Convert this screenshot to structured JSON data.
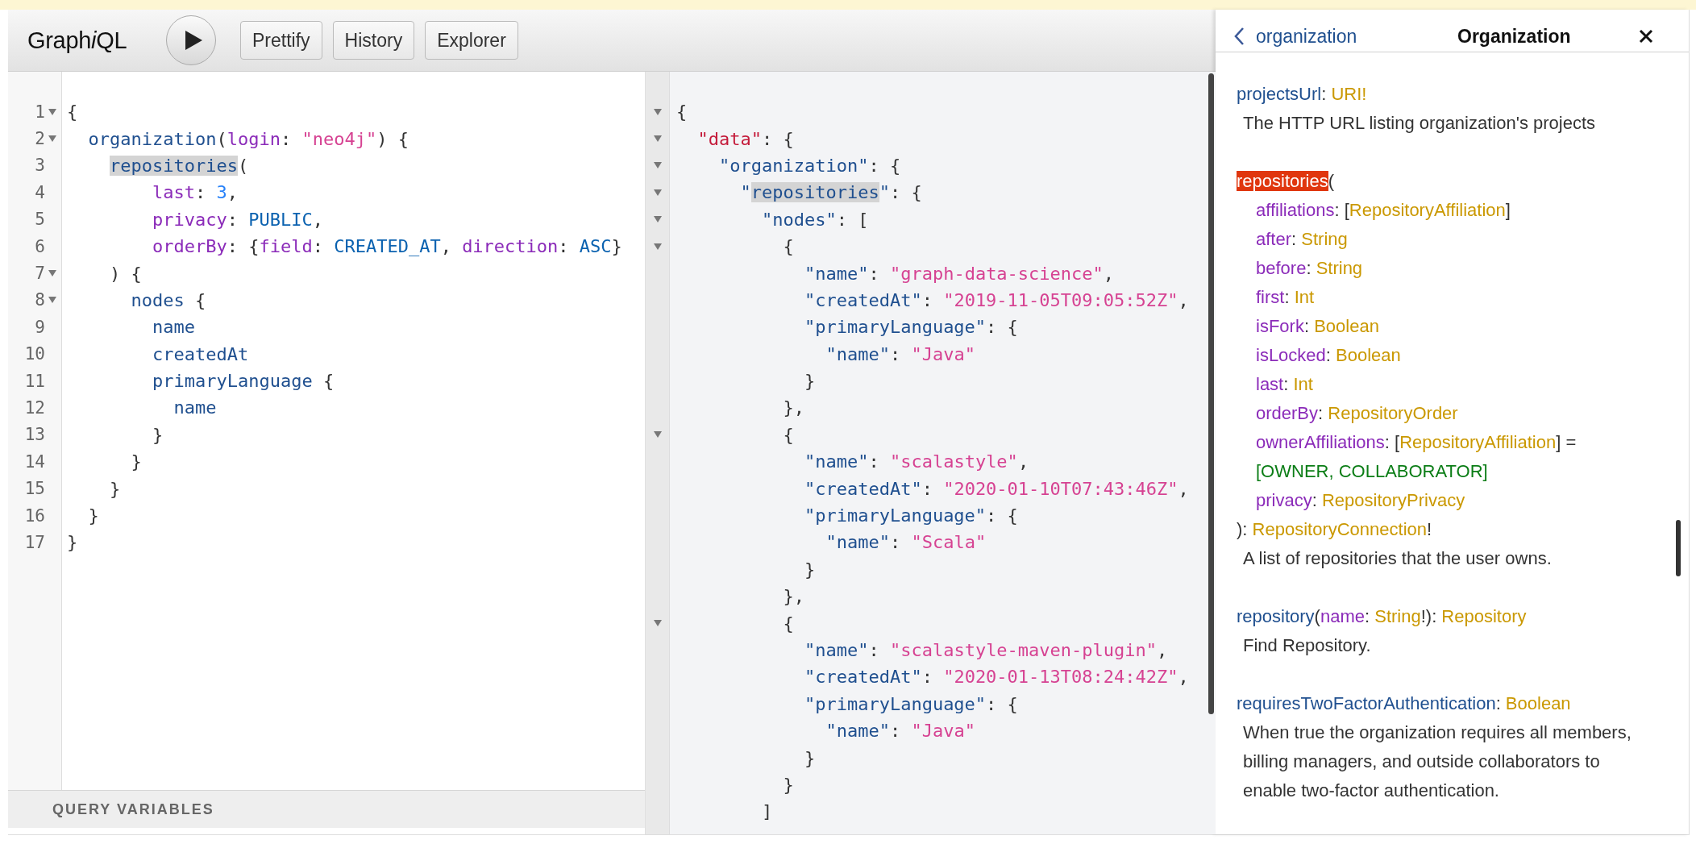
{
  "toolbar": {
    "logo": {
      "before": "Graph",
      "italic": "i",
      "after": "QL"
    },
    "buttons": [
      "Prettify",
      "History",
      "Explorer"
    ]
  },
  "query_editor": {
    "lines": [
      {
        "number": "1",
        "fold": true,
        "tokens": [
          {
            "kind": "p",
            "text": "{"
          }
        ]
      },
      {
        "number": "2",
        "fold": true,
        "tokens": [
          {
            "kind": "f",
            "text": "  organization"
          },
          {
            "kind": "p",
            "text": "("
          },
          {
            "kind": "a",
            "text": "login"
          },
          {
            "kind": "p",
            "text": ": "
          },
          {
            "kind": "s",
            "text": "\"neo4j\""
          },
          {
            "kind": "p",
            "text": ") {"
          }
        ]
      },
      {
        "number": "3",
        "fold": false,
        "tokens": [
          {
            "kind": "match",
            "text": "    repositories"
          },
          {
            "kind": "p",
            "text": "("
          }
        ]
      },
      {
        "number": "4",
        "fold": false,
        "tokens": [
          {
            "kind": "a",
            "text": "        last"
          },
          {
            "kind": "p",
            "text": ": "
          },
          {
            "kind": "n",
            "text": "3"
          },
          {
            "kind": "p",
            "text": ","
          }
        ]
      },
      {
        "number": "5",
        "fold": false,
        "tokens": [
          {
            "kind": "a",
            "text": "        privacy"
          },
          {
            "kind": "p",
            "text": ": "
          },
          {
            "kind": "e",
            "text": "PUBLIC"
          },
          {
            "kind": "p",
            "text": ","
          }
        ]
      },
      {
        "number": "6",
        "fold": false,
        "tokens": [
          {
            "kind": "a",
            "text": "        orderBy"
          },
          {
            "kind": "p",
            "text": ": {"
          },
          {
            "kind": "a",
            "text": "field"
          },
          {
            "kind": "p",
            "text": ": "
          },
          {
            "kind": "e",
            "text": "CREATED_AT"
          },
          {
            "kind": "p",
            "text": ", "
          },
          {
            "kind": "a",
            "text": "direction"
          },
          {
            "kind": "p",
            "text": ": "
          },
          {
            "kind": "e",
            "text": "ASC"
          },
          {
            "kind": "p",
            "text": "}"
          }
        ]
      },
      {
        "number": "7",
        "fold": true,
        "tokens": [
          {
            "kind": "p",
            "text": "    ) {"
          }
        ]
      },
      {
        "number": "8",
        "fold": true,
        "tokens": [
          {
            "kind": "f",
            "text": "      nodes"
          },
          {
            "kind": "p",
            "text": " {"
          }
        ]
      },
      {
        "number": "9",
        "fold": false,
        "tokens": [
          {
            "kind": "f",
            "text": "        name"
          }
        ]
      },
      {
        "number": "10",
        "fold": false,
        "tokens": [
          {
            "kind": "f",
            "text": "        createdAt"
          }
        ]
      },
      {
        "number": "11",
        "fold": false,
        "tokens": [
          {
            "kind": "f",
            "text": "        primaryLanguage"
          },
          {
            "kind": "p",
            "text": " {"
          }
        ]
      },
      {
        "number": "12",
        "fold": false,
        "tokens": [
          {
            "kind": "f",
            "text": "          name"
          }
        ]
      },
      {
        "number": "13",
        "fold": false,
        "tokens": [
          {
            "kind": "p",
            "text": "        }"
          }
        ]
      },
      {
        "number": "14",
        "fold": false,
        "tokens": [
          {
            "kind": "p",
            "text": "      }"
          }
        ]
      },
      {
        "number": "15",
        "fold": false,
        "tokens": [
          {
            "kind": "p",
            "text": "    }"
          }
        ]
      },
      {
        "number": "16",
        "fold": false,
        "tokens": [
          {
            "kind": "p",
            "text": "  }"
          }
        ]
      },
      {
        "number": "17",
        "fold": false,
        "tokens": [
          {
            "kind": "p",
            "text": "}"
          }
        ]
      }
    ],
    "variables_label": "QUERY VARIABLES"
  },
  "result": {
    "lines": [
      {
        "fold": true,
        "tokens": [
          {
            "kind": "p",
            "text": "{"
          }
        ]
      },
      {
        "fold": true,
        "tokens": [
          {
            "kind": "root",
            "text": "  \"data\""
          },
          {
            "kind": "p",
            "text": ": {"
          }
        ]
      },
      {
        "fold": true,
        "tokens": [
          {
            "kind": "f",
            "text": "    \"organization\""
          },
          {
            "kind": "p",
            "text": ": {"
          }
        ]
      },
      {
        "fold": true,
        "tokens": [
          {
            "kind": "f",
            "text": "      \""
          },
          {
            "kind": "match",
            "text": "repositories"
          },
          {
            "kind": "f",
            "text": "\""
          },
          {
            "kind": "p",
            "text": ": {"
          }
        ]
      },
      {
        "fold": true,
        "tokens": [
          {
            "kind": "f",
            "text": "        \"nodes\""
          },
          {
            "kind": "p",
            "text": ": ["
          }
        ]
      },
      {
        "fold": true,
        "tokens": [
          {
            "kind": "p",
            "text": "          {"
          }
        ]
      },
      {
        "fold": false,
        "tokens": [
          {
            "kind": "f",
            "text": "            \"name\""
          },
          {
            "kind": "p",
            "text": ": "
          },
          {
            "kind": "s",
            "text": "\"graph-data-science\""
          },
          {
            "kind": "p",
            "text": ","
          }
        ]
      },
      {
        "fold": false,
        "tokens": [
          {
            "kind": "f",
            "text": "            \"createdAt\""
          },
          {
            "kind": "p",
            "text": ": "
          },
          {
            "kind": "s",
            "text": "\"2019-11-05T09:05:52Z\""
          },
          {
            "kind": "p",
            "text": ","
          }
        ]
      },
      {
        "fold": false,
        "tokens": [
          {
            "kind": "f",
            "text": "            \"primaryLanguage\""
          },
          {
            "kind": "p",
            "text": ": {"
          }
        ]
      },
      {
        "fold": false,
        "tokens": [
          {
            "kind": "f",
            "text": "              \"name\""
          },
          {
            "kind": "p",
            "text": ": "
          },
          {
            "kind": "s",
            "text": "\"Java\""
          }
        ]
      },
      {
        "fold": false,
        "tokens": [
          {
            "kind": "p",
            "text": "            }"
          }
        ]
      },
      {
        "fold": false,
        "tokens": [
          {
            "kind": "p",
            "text": "          },"
          }
        ]
      },
      {
        "fold": true,
        "tokens": [
          {
            "kind": "p",
            "text": "          {"
          }
        ]
      },
      {
        "fold": false,
        "tokens": [
          {
            "kind": "f",
            "text": "            \"name\""
          },
          {
            "kind": "p",
            "text": ": "
          },
          {
            "kind": "s",
            "text": "\"scalastyle\""
          },
          {
            "kind": "p",
            "text": ","
          }
        ]
      },
      {
        "fold": false,
        "tokens": [
          {
            "kind": "f",
            "text": "            \"createdAt\""
          },
          {
            "kind": "p",
            "text": ": "
          },
          {
            "kind": "s",
            "text": "\"2020-01-10T07:43:46Z\""
          },
          {
            "kind": "p",
            "text": ","
          }
        ]
      },
      {
        "fold": false,
        "tokens": [
          {
            "kind": "f",
            "text": "            \"primaryLanguage\""
          },
          {
            "kind": "p",
            "text": ": {"
          }
        ]
      },
      {
        "fold": false,
        "tokens": [
          {
            "kind": "f",
            "text": "              \"name\""
          },
          {
            "kind": "p",
            "text": ": "
          },
          {
            "kind": "s",
            "text": "\"Scala\""
          }
        ]
      },
      {
        "fold": false,
        "tokens": [
          {
            "kind": "p",
            "text": "            }"
          }
        ]
      },
      {
        "fold": false,
        "tokens": [
          {
            "kind": "p",
            "text": "          },"
          }
        ]
      },
      {
        "fold": true,
        "tokens": [
          {
            "kind": "p",
            "text": "          {"
          }
        ]
      },
      {
        "fold": false,
        "tokens": [
          {
            "kind": "f",
            "text": "            \"name\""
          },
          {
            "kind": "p",
            "text": ": "
          },
          {
            "kind": "s",
            "text": "\"scalastyle-maven-plugin\""
          },
          {
            "kind": "p",
            "text": ","
          }
        ]
      },
      {
        "fold": false,
        "tokens": [
          {
            "kind": "f",
            "text": "            \"createdAt\""
          },
          {
            "kind": "p",
            "text": ": "
          },
          {
            "kind": "s",
            "text": "\"2020-01-13T08:24:42Z\""
          },
          {
            "kind": "p",
            "text": ","
          }
        ]
      },
      {
        "fold": false,
        "tokens": [
          {
            "kind": "f",
            "text": "            \"primaryLanguage\""
          },
          {
            "kind": "p",
            "text": ": {"
          }
        ]
      },
      {
        "fold": false,
        "tokens": [
          {
            "kind": "f",
            "text": "              \"name\""
          },
          {
            "kind": "p",
            "text": ": "
          },
          {
            "kind": "s",
            "text": "\"Java\""
          }
        ]
      },
      {
        "fold": false,
        "tokens": [
          {
            "kind": "p",
            "text": "            }"
          }
        ]
      },
      {
        "fold": false,
        "tokens": [
          {
            "kind": "p",
            "text": "          }"
          }
        ]
      },
      {
        "fold": false,
        "tokens": [
          {
            "kind": "p",
            "text": "        ]"
          }
        ]
      }
    ]
  },
  "docs": {
    "back_label": "organization",
    "title": "Organization",
    "entries": [
      {
        "lines": [
          {
            "kind": "sig",
            "tokens": [
              {
                "kind": "field",
                "text": "projectsUrl"
              },
              {
                "kind": "p",
                "text": ": "
              },
              {
                "kind": "type",
                "text": "URI!"
              }
            ]
          },
          {
            "kind": "desc",
            "tokens": [
              {
                "kind": "p",
                "text": "The HTTP URL listing organization's projects"
              }
            ]
          }
        ]
      },
      {
        "lines": [
          {
            "kind": "sig",
            "tokens": [
              {
                "kind": "active",
                "text": "repositories"
              },
              {
                "kind": "p",
                "text": "("
              }
            ]
          },
          {
            "kind": "arg",
            "tokens": [
              {
                "kind": "arg",
                "text": "affiliations"
              },
              {
                "kind": "p",
                "text": ": ["
              },
              {
                "kind": "type",
                "text": "RepositoryAffiliation"
              },
              {
                "kind": "p",
                "text": "]"
              }
            ]
          },
          {
            "kind": "arg",
            "tokens": [
              {
                "kind": "arg",
                "text": "after"
              },
              {
                "kind": "p",
                "text": ": "
              },
              {
                "kind": "type",
                "text": "String"
              }
            ]
          },
          {
            "kind": "arg",
            "tokens": [
              {
                "kind": "arg",
                "text": "before"
              },
              {
                "kind": "p",
                "text": ": "
              },
              {
                "kind": "type",
                "text": "String"
              }
            ]
          },
          {
            "kind": "arg",
            "tokens": [
              {
                "kind": "arg",
                "text": "first"
              },
              {
                "kind": "p",
                "text": ": "
              },
              {
                "kind": "type",
                "text": "Int"
              }
            ]
          },
          {
            "kind": "arg",
            "tokens": [
              {
                "kind": "arg",
                "text": "isFork"
              },
              {
                "kind": "p",
                "text": ": "
              },
              {
                "kind": "type",
                "text": "Boolean"
              }
            ]
          },
          {
            "kind": "arg",
            "tokens": [
              {
                "kind": "arg",
                "text": "isLocked"
              },
              {
                "kind": "p",
                "text": ": "
              },
              {
                "kind": "type",
                "text": "Boolean"
              }
            ]
          },
          {
            "kind": "arg",
            "tokens": [
              {
                "kind": "arg",
                "text": "last"
              },
              {
                "kind": "p",
                "text": ": "
              },
              {
                "kind": "type",
                "text": "Int"
              }
            ]
          },
          {
            "kind": "arg",
            "tokens": [
              {
                "kind": "arg",
                "text": "orderBy"
              },
              {
                "kind": "p",
                "text": ": "
              },
              {
                "kind": "type",
                "text": "RepositoryOrder"
              }
            ]
          },
          {
            "kind": "arg",
            "tokens": [
              {
                "kind": "arg",
                "text": "ownerAffiliations"
              },
              {
                "kind": "p",
                "text": ": ["
              },
              {
                "kind": "type",
                "text": "RepositoryAffiliation"
              },
              {
                "kind": "p",
                "text": "] ="
              }
            ]
          },
          {
            "kind": "arg",
            "tokens": [
              {
                "kind": "default",
                "text": "[OWNER, COLLABORATOR]"
              }
            ]
          },
          {
            "kind": "arg",
            "tokens": [
              {
                "kind": "arg",
                "text": "privacy"
              },
              {
                "kind": "p",
                "text": ": "
              },
              {
                "kind": "type",
                "text": "RepositoryPrivacy"
              }
            ]
          },
          {
            "kind": "sig",
            "tokens": [
              {
                "kind": "p",
                "text": "): "
              },
              {
                "kind": "type",
                "text": "RepositoryConnection"
              },
              {
                "kind": "p",
                "text": "!"
              }
            ]
          },
          {
            "kind": "desc",
            "tokens": [
              {
                "kind": "p",
                "text": "A list of repositories that the user owns."
              }
            ]
          }
        ]
      },
      {
        "lines": [
          {
            "kind": "sig",
            "tokens": [
              {
                "kind": "field",
                "text": "repository"
              },
              {
                "kind": "p",
                "text": "("
              },
              {
                "kind": "arg",
                "text": "name"
              },
              {
                "kind": "p",
                "text": ": "
              },
              {
                "kind": "type",
                "text": "String"
              },
              {
                "kind": "p",
                "text": "!): "
              },
              {
                "kind": "type",
                "text": "Repository"
              }
            ]
          },
          {
            "kind": "desc",
            "tokens": [
              {
                "kind": "p",
                "text": "Find Repository."
              }
            ]
          }
        ]
      },
      {
        "lines": [
          {
            "kind": "sig",
            "tokens": [
              {
                "kind": "field",
                "text": "requiresTwoFactorAuthentication"
              },
              {
                "kind": "p",
                "text": ": "
              },
              {
                "kind": "type",
                "text": "Boolean"
              }
            ]
          },
          {
            "kind": "desc",
            "tokens": [
              {
                "kind": "p",
                "text": "When true the organization requires all members, billing managers, and outside collaborators to enable two-factor authentication."
              }
            ]
          }
        ]
      }
    ]
  }
}
